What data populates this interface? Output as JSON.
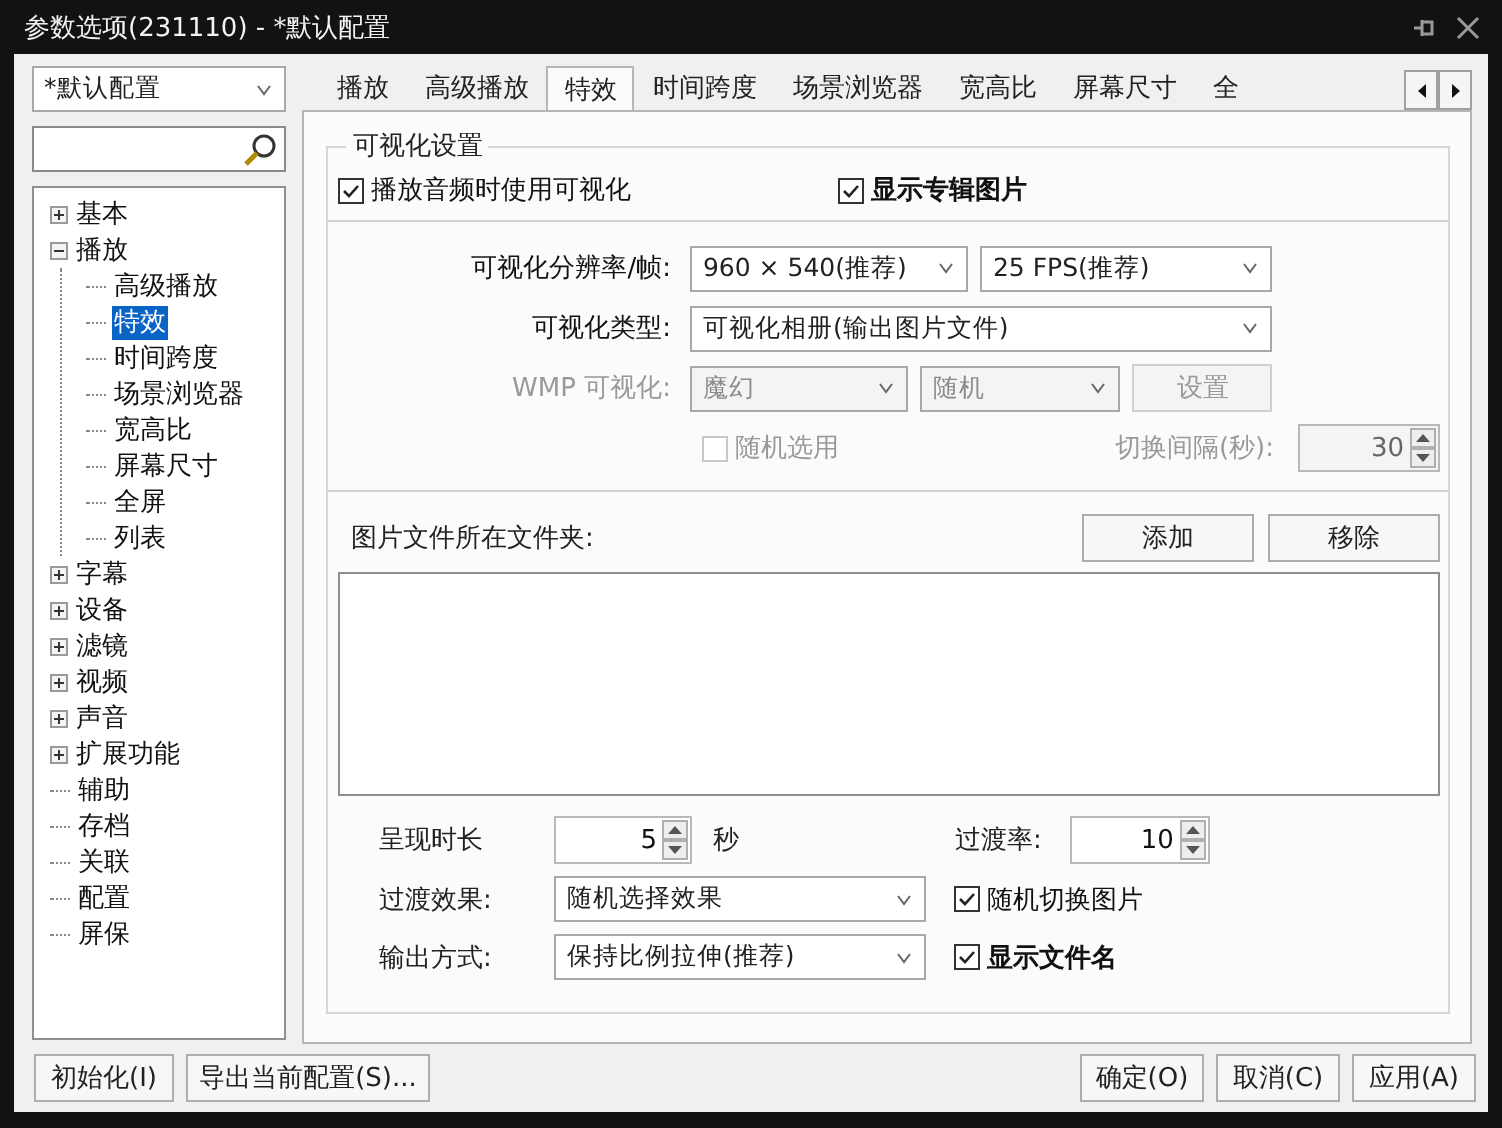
{
  "window": {
    "title": "参数选项(231110) - *默认配置"
  },
  "profile_select": {
    "value": "*默认配置"
  },
  "tree": [
    {
      "label": "基本",
      "kind": "folder",
      "expanded": false,
      "selected": false
    },
    {
      "label": "播放",
      "kind": "folder",
      "expanded": true,
      "selected": false,
      "children": [
        {
          "label": "高级播放",
          "selected": false
        },
        {
          "label": "特效",
          "selected": true
        },
        {
          "label": "时间跨度",
          "selected": false
        },
        {
          "label": "场景浏览器",
          "selected": false
        },
        {
          "label": "宽高比",
          "selected": false
        },
        {
          "label": "屏幕尺寸",
          "selected": false
        },
        {
          "label": "全屏",
          "selected": false
        },
        {
          "label": "列表",
          "selected": false
        }
      ]
    },
    {
      "label": "字幕",
      "kind": "folder",
      "expanded": false,
      "selected": false
    },
    {
      "label": "设备",
      "kind": "folder",
      "expanded": false,
      "selected": false
    },
    {
      "label": "滤镜",
      "kind": "folder",
      "expanded": false,
      "selected": false
    },
    {
      "label": "视频",
      "kind": "folder",
      "expanded": false,
      "selected": false
    },
    {
      "label": "声音",
      "kind": "folder",
      "expanded": false,
      "selected": false
    },
    {
      "label": "扩展功能",
      "kind": "folder",
      "expanded": false,
      "selected": false
    },
    {
      "label": "辅助",
      "kind": "leaf",
      "selected": false
    },
    {
      "label": "存档",
      "kind": "leaf",
      "selected": false
    },
    {
      "label": "关联",
      "kind": "leaf",
      "selected": false
    },
    {
      "label": "配置",
      "kind": "leaf",
      "selected": false
    },
    {
      "label": "屏保",
      "kind": "leaf",
      "selected": false
    }
  ],
  "tabs": [
    {
      "label": "播放",
      "selected": false
    },
    {
      "label": "高级播放",
      "selected": false
    },
    {
      "label": "特效",
      "selected": true
    },
    {
      "label": "时间跨度",
      "selected": false
    },
    {
      "label": "场景浏览器",
      "selected": false
    },
    {
      "label": "宽高比",
      "selected": false
    },
    {
      "label": "屏幕尺寸",
      "selected": false
    },
    {
      "label": "全",
      "selected": false
    }
  ],
  "visual_group": {
    "title": "可视化设置",
    "checkboxes": [
      {
        "label": "播放音频时使用可视化",
        "checked": true,
        "bold": false
      },
      {
        "label": "显示专辑图片",
        "checked": true,
        "bold": true
      }
    ]
  },
  "resolution": {
    "label": "可视化分辨率/帧:",
    "values": [
      "960 × 540(推荐)",
      "25 FPS(推荐)"
    ]
  },
  "vis_type": {
    "label": "可视化类型:",
    "value": "可视化相册(输出图片文件)"
  },
  "wmp": {
    "label": "WMP 可视化:",
    "disabled": true,
    "values": [
      "魔幻",
      "随机"
    ],
    "button": "设置"
  },
  "random": {
    "label": "随机选用",
    "checked": false,
    "disabled": true,
    "interval_label": "切换间隔(秒):",
    "interval": "30"
  },
  "folder": {
    "label": "图片文件所在文件夹:",
    "buttons": [
      "添加",
      "移除"
    ]
  },
  "duration": {
    "label": "呈现时长",
    "value": "5",
    "unit": "秒"
  },
  "rate": {
    "label": "过渡率:",
    "value": "10"
  },
  "effect": {
    "label": "过渡效果:",
    "value": "随机选择效果"
  },
  "output": {
    "label": "输出方式:",
    "value": "保持比例拉伸(推荐)"
  },
  "options": [
    {
      "label": "随机切换图片",
      "checked": true,
      "bold": false
    },
    {
      "label": "显示文件名",
      "checked": true,
      "bold": true
    }
  ],
  "footer_left": [
    "初始化(I)",
    "导出当前配置(S)..."
  ],
  "footer_right": [
    "确定(O)",
    "取消(C)",
    "应用(A)"
  ]
}
